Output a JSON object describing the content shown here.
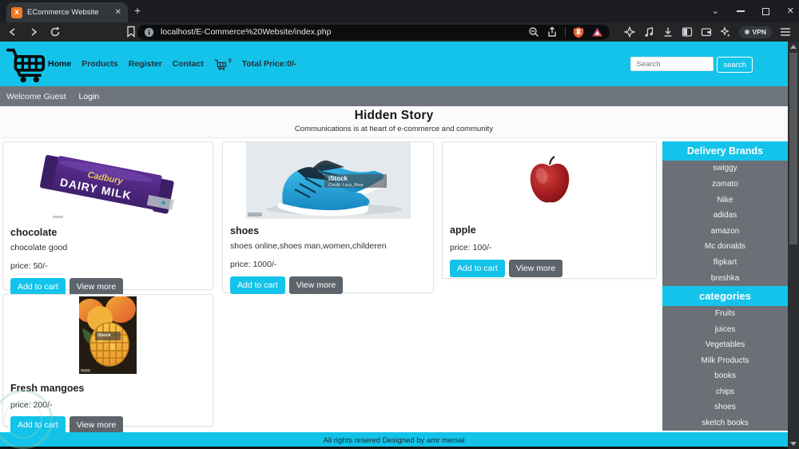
{
  "browser": {
    "tab_title": "ECommerce Website",
    "url": "localhost/E-Commerce%20Website/index.php",
    "vpn_label": "VPN"
  },
  "navbar": {
    "links": [
      "Home",
      "Products",
      "Register",
      "Contact"
    ],
    "cart_count": "0",
    "total_price": "Total Price:0/-",
    "search_placeholder": "Search",
    "search_button": "search"
  },
  "welcome_bar": {
    "welcome": "Welcome Guest",
    "login": "Login"
  },
  "hero": {
    "title": "Hidden Story",
    "subtitle": "Communications is at heart of e-commerce and community"
  },
  "products": [
    {
      "name": "chocolate",
      "desc": "chocolate good",
      "price": "price: 50/-",
      "add_label": "Add to cart",
      "view_label": "View more",
      "image_brand": "Cadbury",
      "image_label": "DAIRY MILK"
    },
    {
      "name": "shoes",
      "desc": "shoes online,shoes man,women,childeren",
      "price": "price: 1000/-",
      "add_label": "Add to cart",
      "view_label": "View more",
      "watermark": "iStock",
      "watermark_credit": "Credit: Lazy_Bear"
    },
    {
      "name": "apple",
      "desc": "",
      "price": "price: 100/-",
      "add_label": "Add to cart",
      "view_label": "View more"
    },
    {
      "name": "Fresh mangoes",
      "desc": "",
      "price": "price: 200/-",
      "add_label": "Add to cart",
      "view_label": "View more",
      "watermark": "iStock"
    }
  ],
  "sidebar": {
    "brands_title": "Delivery Brands",
    "brands": [
      "swiggy",
      "zomato",
      "Nike",
      "adidas",
      "amazon",
      "Mc donalds",
      "flipkart",
      "breshka"
    ],
    "categories_title": "categories",
    "categories": [
      "Fruits",
      "juices",
      "Vegetables",
      "Milk Products",
      "books",
      "chips",
      "shoes",
      "sketch books"
    ]
  },
  "footer": {
    "text": "All rights resered Designed by amr mersal"
  },
  "colors": {
    "accent": "#13c3e9",
    "bar_gray": "#6e747b",
    "button_gray": "#5d646b"
  }
}
